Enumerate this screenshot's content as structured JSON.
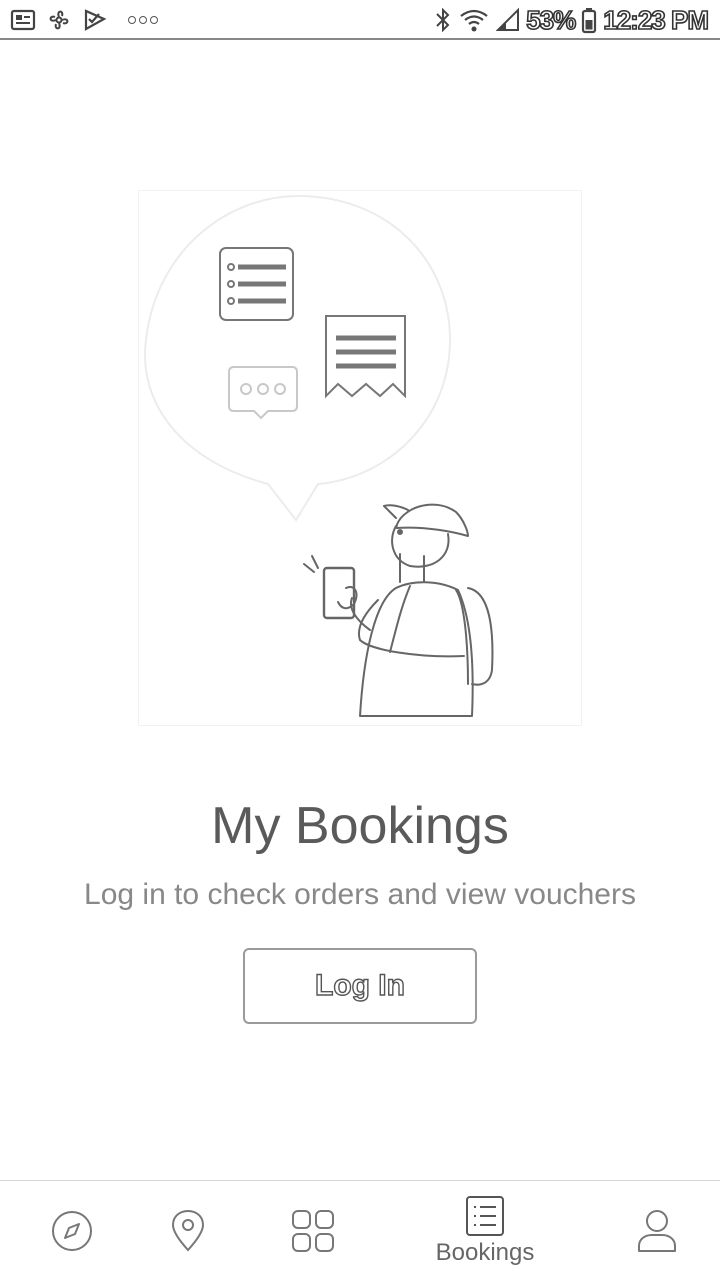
{
  "status_bar": {
    "battery": "53%",
    "time": "12:23 PM",
    "left_icons": [
      "gallery-icon",
      "pinwheel-icon",
      "check-icon",
      "more-dots-icon"
    ],
    "right_icons": [
      "bluetooth-icon",
      "wifi-icon",
      "signal-icon",
      "battery-icon"
    ]
  },
  "main": {
    "title": "My Bookings",
    "subtitle": "Log in to check orders and view vouchers",
    "login_label": "Log In"
  },
  "bottom_nav": {
    "items": [
      {
        "icon": "compass-icon",
        "label": ""
      },
      {
        "icon": "location-pin-icon",
        "label": ""
      },
      {
        "icon": "grid-icon",
        "label": ""
      },
      {
        "icon": "bookings-list-icon",
        "label": "Bookings",
        "active": true
      },
      {
        "icon": "person-icon",
        "label": ""
      }
    ]
  },
  "colors": {
    "line": "#666666",
    "light_line": "#cfcfcf"
  }
}
